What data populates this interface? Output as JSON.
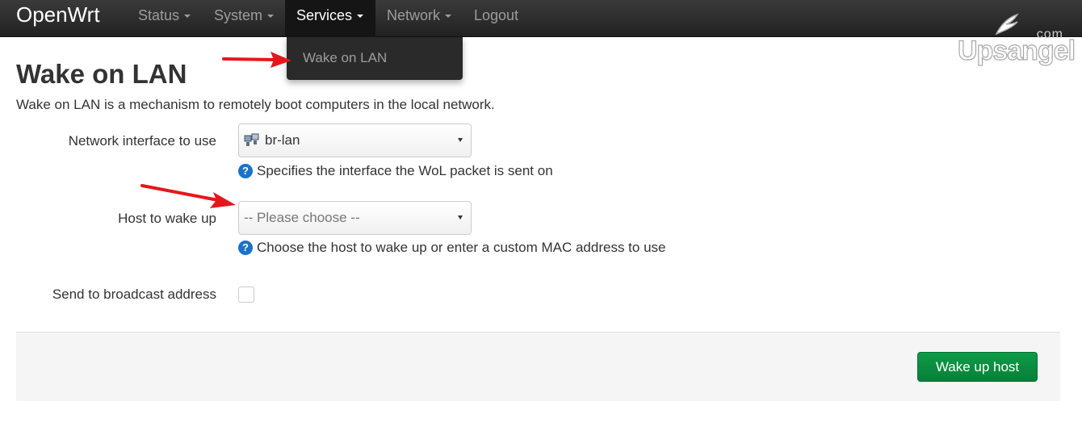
{
  "navbar": {
    "brand": "OpenWrt",
    "items": [
      {
        "label": "Status"
      },
      {
        "label": "System"
      },
      {
        "label": "Services"
      },
      {
        "label": "Network"
      },
      {
        "label": "Logout"
      }
    ],
    "active_index": 2
  },
  "dropdown": {
    "items": [
      {
        "label": "Wake on LAN"
      }
    ]
  },
  "watermark": {
    "text": "Upsangel",
    "suffix": "com"
  },
  "page": {
    "title": "Wake on LAN",
    "description": "Wake on LAN is a mechanism to remotely boot computers in the local network."
  },
  "form": {
    "interface": {
      "label": "Network interface to use",
      "value": "br-lan",
      "help": "Specifies the interface the WoL packet is sent on"
    },
    "host": {
      "label": "Host to wake up",
      "placeholder": "-- Please choose --",
      "help": "Choose the host to wake up or enter a custom MAC address to use"
    },
    "broadcast": {
      "label": "Send to broadcast address",
      "checked": false
    }
  },
  "actions": {
    "submit_label": "Wake up host"
  },
  "colors": {
    "navbar_bg": "#222222",
    "primary_button": "#0a8f40",
    "help_icon": "#1a73c8",
    "annotation_arrow": "#e8151b"
  },
  "icons": {
    "interface": "network-interface-icon",
    "help": "question-icon"
  }
}
